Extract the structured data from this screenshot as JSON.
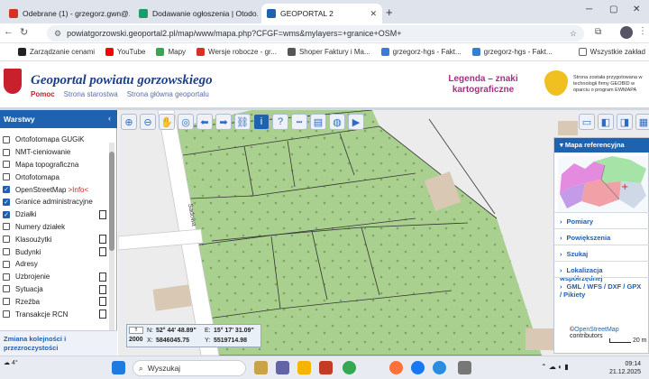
{
  "browser": {
    "tabs": [
      {
        "label": "Odebrane (1) - grzegorz.gwn@...",
        "favicon_color": "#d93025"
      },
      {
        "label": "Dodawanie ogłoszenia | Otodo...",
        "favicon_color": "#1a9d6b"
      },
      {
        "label": "GEOPORTAL 2",
        "favicon_color": "#1f63b0"
      }
    ],
    "new_tab": "+",
    "url": "powiatgorzowski.geoportal2.pl/map/www/mapa.php?CFGF=wms&mylayers=+granice+OSM+",
    "bookmarks": [
      {
        "label": "Zarządzanie cenami",
        "color": "#222"
      },
      {
        "label": "YouTube",
        "color": "#ff0000"
      },
      {
        "label": "Mapy",
        "color": "#34a853"
      },
      {
        "label": "Wersje robocze - gr...",
        "color": "#d93025"
      },
      {
        "label": "Shoper Faktury i Ma...",
        "color": "#555"
      },
      {
        "label": "grzegorz-hgs - Fakt...",
        "color": "#3a7bd5"
      },
      {
        "label": "grzegorz-hgs - Fakt...",
        "color": "#3a7bd5"
      }
    ],
    "all_bookmarks": "Wszystkie zakład"
  },
  "header": {
    "title": "Geoportal powiatu gorzowskiego",
    "links": [
      "Pomoc",
      "Strona starostwa",
      "Strona główna geoportalu"
    ],
    "legend": "Legenda – znaki kartograficzne",
    "geobid_text": "Strona została przygotowana w technologii firmy GEOBID w oparciu o program EWMAPA"
  },
  "left_panel": {
    "heading": "Warstwy",
    "layers": [
      {
        "label": "Ortofotomapa GUGiK",
        "checked": false,
        "doc": false
      },
      {
        "label": "NMT-cieniowanie",
        "checked": false,
        "doc": false
      },
      {
        "label": "Mapa topograficzna",
        "checked": false,
        "doc": false
      },
      {
        "label": "Ortofotomapa",
        "checked": false,
        "doc": false
      },
      {
        "label": "OpenStreetMap",
        "checked": true,
        "doc": false,
        "extra": ">Info<"
      },
      {
        "label": "Granice administracyjne",
        "checked": true,
        "doc": false
      },
      {
        "label": "Działki",
        "checked": true,
        "doc": true
      },
      {
        "label": "Numery działek",
        "checked": false,
        "doc": false
      },
      {
        "label": "Klasoużytki",
        "checked": false,
        "doc": true
      },
      {
        "label": "Budynki",
        "checked": false,
        "doc": true
      },
      {
        "label": "Adresy",
        "checked": false,
        "doc": false
      },
      {
        "label": "Uzbrojenie",
        "checked": false,
        "doc": true
      },
      {
        "label": "Sytuacja",
        "checked": false,
        "doc": true
      },
      {
        "label": "Rzeźba",
        "checked": false,
        "doc": true
      },
      {
        "label": "Transakcje RCN",
        "checked": false,
        "doc": true
      }
    ],
    "footer": "Zmiana kolejności i przezroczystości"
  },
  "map": {
    "street_label": "Sadowa",
    "colors": {
      "parcel_fill": "#a9d08e",
      "road": "#ffffff",
      "building": "#d8c8b4"
    }
  },
  "right_panel": {
    "heading": "Mapa referencyjna",
    "menu": [
      "Pomiary",
      "Powiększenia",
      "Szukaj",
      "Lokalizacja współrzędnej",
      "GML / WFS / DXF / GPX / Pikiety"
    ]
  },
  "coords": {
    "system": "2000",
    "n_label": "N:",
    "n_value": "52° 44' 48.89\"",
    "e_label": "E:",
    "e_value": "15° 17' 31.09\"",
    "x_label": "X:",
    "x_value": "5846045.75",
    "y_label": "Y:",
    "y_value": "5519714.98"
  },
  "attribution": {
    "prefix": "©",
    "link": "OpenStreetMap",
    "suffix": " contributors"
  },
  "scale": "20 m",
  "taskbar": {
    "weather": "4°",
    "search_placeholder": "Wyszukaj",
    "time": "09:14",
    "date": "21.12.2025"
  }
}
